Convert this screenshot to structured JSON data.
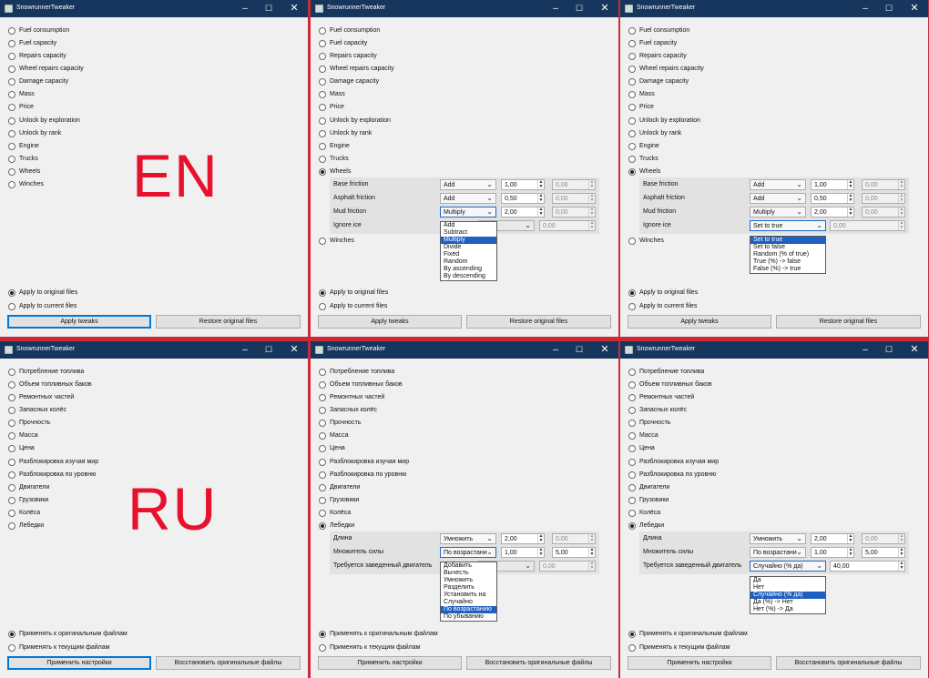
{
  "title": "SnowrunnerTweaker",
  "colors": {
    "divider": "#cc2a36",
    "titlebar": "#17365d",
    "highlight": "#1f5fbf",
    "lang_label": "#e8112d"
  },
  "en": {
    "lang_label": "EN",
    "options": [
      "Fuel consumption",
      "Fuel capacity",
      "Repairs capacity",
      "Wheel repairs capacity",
      "Damage capacity",
      "Mass",
      "Price",
      "Unlock by exploration",
      "Unlock by rank",
      "Engine",
      "Trucks",
      "Wheels",
      "Winches"
    ],
    "apply_original": "Apply to original files",
    "apply_current": "Apply to current files",
    "apply_button": "Apply tweaks",
    "restore_button": "Restore original files",
    "win2": {
      "rows": [
        {
          "label": "Base friction",
          "op": "Add",
          "v1": "1,00",
          "v2": "0,00"
        },
        {
          "label": "Asphalt friction",
          "op": "Add",
          "v1": "0,50",
          "v2": "0,00"
        },
        {
          "label": "Mud friction",
          "op": "Multiply",
          "v1": "2,00",
          "v2": "0,00"
        },
        {
          "label": "Ignore ice",
          "op": "",
          "v1": "0,00"
        }
      ],
      "dropdown": [
        "Add",
        "Subtract",
        "Multiply",
        "Divide",
        "Fixed",
        "Random",
        "By ascending",
        "By descending"
      ]
    },
    "win3": {
      "rows": [
        {
          "label": "Base friction",
          "op": "Add",
          "v1": "1,00",
          "v2": "0,00"
        },
        {
          "label": "Asphalt friction",
          "op": "Add",
          "v1": "0,50",
          "v2": "0,00"
        },
        {
          "label": "Mud friction",
          "op": "Multiply",
          "v1": "2,00",
          "v2": "0,00"
        },
        {
          "label": "Ignore ice",
          "op": "Set to true",
          "v1": "0,00"
        }
      ],
      "dropdown": [
        "Set to true",
        "Set to false",
        "Random (% of true)",
        "True (%) -> false",
        "False (%) -> true"
      ]
    }
  },
  "ru": {
    "lang_label": "RU",
    "options": [
      "Потребление топлива",
      "Объем топливных баков",
      "Ремонтных частей",
      "Запасных колёс",
      "Прочность",
      "Масса",
      "Цена",
      "Разблокировка изучая мир",
      "Разблокировка по уровню",
      "Двигатели",
      "Грузовики",
      "Колёса",
      "Лебедки"
    ],
    "apply_original": "Применять к оригинальным файлам",
    "apply_current": "Применять к текущим файлам",
    "apply_button": "Применить настройки",
    "restore_button": "Восстановить оригинальные файлы",
    "win2": {
      "rows": [
        {
          "label": "Длина",
          "op": "Умножить",
          "v1": "2,00",
          "v2": "0,00"
        },
        {
          "label": "Множитель силы",
          "op": "По возрастани",
          "v1": "1,00",
          "v2": "5,00"
        },
        {
          "label": "Требуется заведенный двигатель",
          "op": "",
          "v1": "0,00"
        }
      ],
      "dropdown": [
        "Добавить",
        "Вычесть",
        "Умножить",
        "Разделить",
        "Установить на",
        "Случайно",
        "По возрастанию",
        "По убыванию"
      ]
    },
    "win3": {
      "rows": [
        {
          "label": "Длина",
          "op": "Умножить",
          "v1": "2,00",
          "v2": "0,00"
        },
        {
          "label": "Множитель силы",
          "op": "По возрастани",
          "v1": "1,00",
          "v2": "5,00"
        },
        {
          "label": "Требуется заведенный двигатель",
          "op": "Случайно (% да)",
          "v1": "40,00"
        }
      ],
      "dropdown": [
        "Да",
        "Нет",
        "Случайно (% да)",
        "Да (%) -> Нет",
        "Нет (%) -> Да"
      ]
    }
  }
}
